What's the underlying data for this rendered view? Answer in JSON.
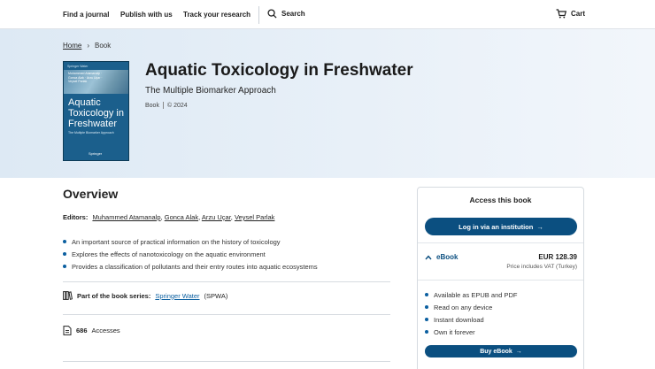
{
  "nav": {
    "find_journal": "Find a journal",
    "publish": "Publish with us",
    "track": "Track your research",
    "search": "Search",
    "cart": "Cart"
  },
  "breadcrumb": {
    "home": "Home",
    "current": "Book"
  },
  "cover": {
    "series": "Springer Water",
    "authors": "Muhammed Atamanalp · Gonca Alak · Arzu Uçar · Veysel Parlak",
    "title": "Aquatic Toxicology in Freshwater",
    "subtitle": "The Multiple Biomarker Approach",
    "publisher": "Springer"
  },
  "book": {
    "title": "Aquatic Toxicology in Freshwater",
    "subtitle": "The Multiple Biomarker Approach",
    "type": "Book",
    "year": "© 2024"
  },
  "overview": {
    "title": "Overview",
    "editors_label": "Editors:",
    "editors": [
      "Muhammed Atamanalp",
      "Gonca Alak",
      "Arzu Uçar",
      "Veysel Parlak"
    ],
    "bullets": [
      "An important source of practical information on the history of toxicology",
      "Explores the effects of nanotoxicology on the aquatic environment",
      "Provides a classification of pollutants and their entry routes into aquatic ecosystems"
    ],
    "series_label": "Part of the book series:",
    "series_name": "Springer Water",
    "series_abbr": "(SPWA)",
    "accesses_count": "686",
    "accesses_label": "Accesses"
  },
  "access": {
    "title": "Access this book",
    "login": "Log in via an institution",
    "ebook_label": "eBook",
    "price": "EUR 128.39",
    "vat": "Price includes VAT (Turkey)",
    "features": [
      "Available as EPUB and PDF",
      "Read on any device",
      "Instant download",
      "Own it forever"
    ],
    "buy": "Buy eBook"
  },
  "colors": {
    "accent": "#0b4f80",
    "link": "#0b5fa0",
    "hero_bg": "#e3edf6"
  }
}
